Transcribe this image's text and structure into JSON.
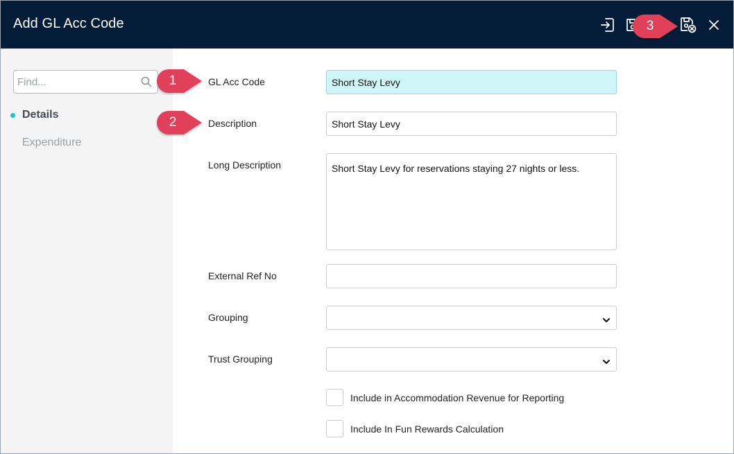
{
  "window": {
    "title": "Add GL Acc Code"
  },
  "header": {
    "icons": [
      "import-icon",
      "save-icon",
      "save-close-icon",
      "close-icon"
    ]
  },
  "sidebar": {
    "search_placeholder": "Find...",
    "items": [
      {
        "label": "Details",
        "active": true
      },
      {
        "label": "Expenditure",
        "active": false
      }
    ]
  },
  "form": {
    "gl_acc_code": {
      "label": "GL Acc Code",
      "value": "Short Stay Levy"
    },
    "description": {
      "label": "Description",
      "value": "Short Stay Levy"
    },
    "long_description": {
      "label": "Long Description",
      "value": "Short Stay Levy for reservations staying 27 nights or less."
    },
    "external_ref_no": {
      "label": "External Ref No",
      "value": ""
    },
    "grouping": {
      "label": "Grouping",
      "value": ""
    },
    "trust_grouping": {
      "label": "Trust Grouping",
      "value": ""
    },
    "checkboxes": [
      {
        "label": "Include in Accommodation Revenue for Reporting",
        "checked": false
      },
      {
        "label": "Include In Fun Rewards Calculation",
        "checked": false
      }
    ]
  },
  "callouts": [
    "1",
    "2",
    "3"
  ],
  "colors": {
    "header_bg": "#051c38",
    "accent": "#1fc3d3",
    "highlight_field": "#d0f5f8",
    "callout": "#e0405a"
  }
}
